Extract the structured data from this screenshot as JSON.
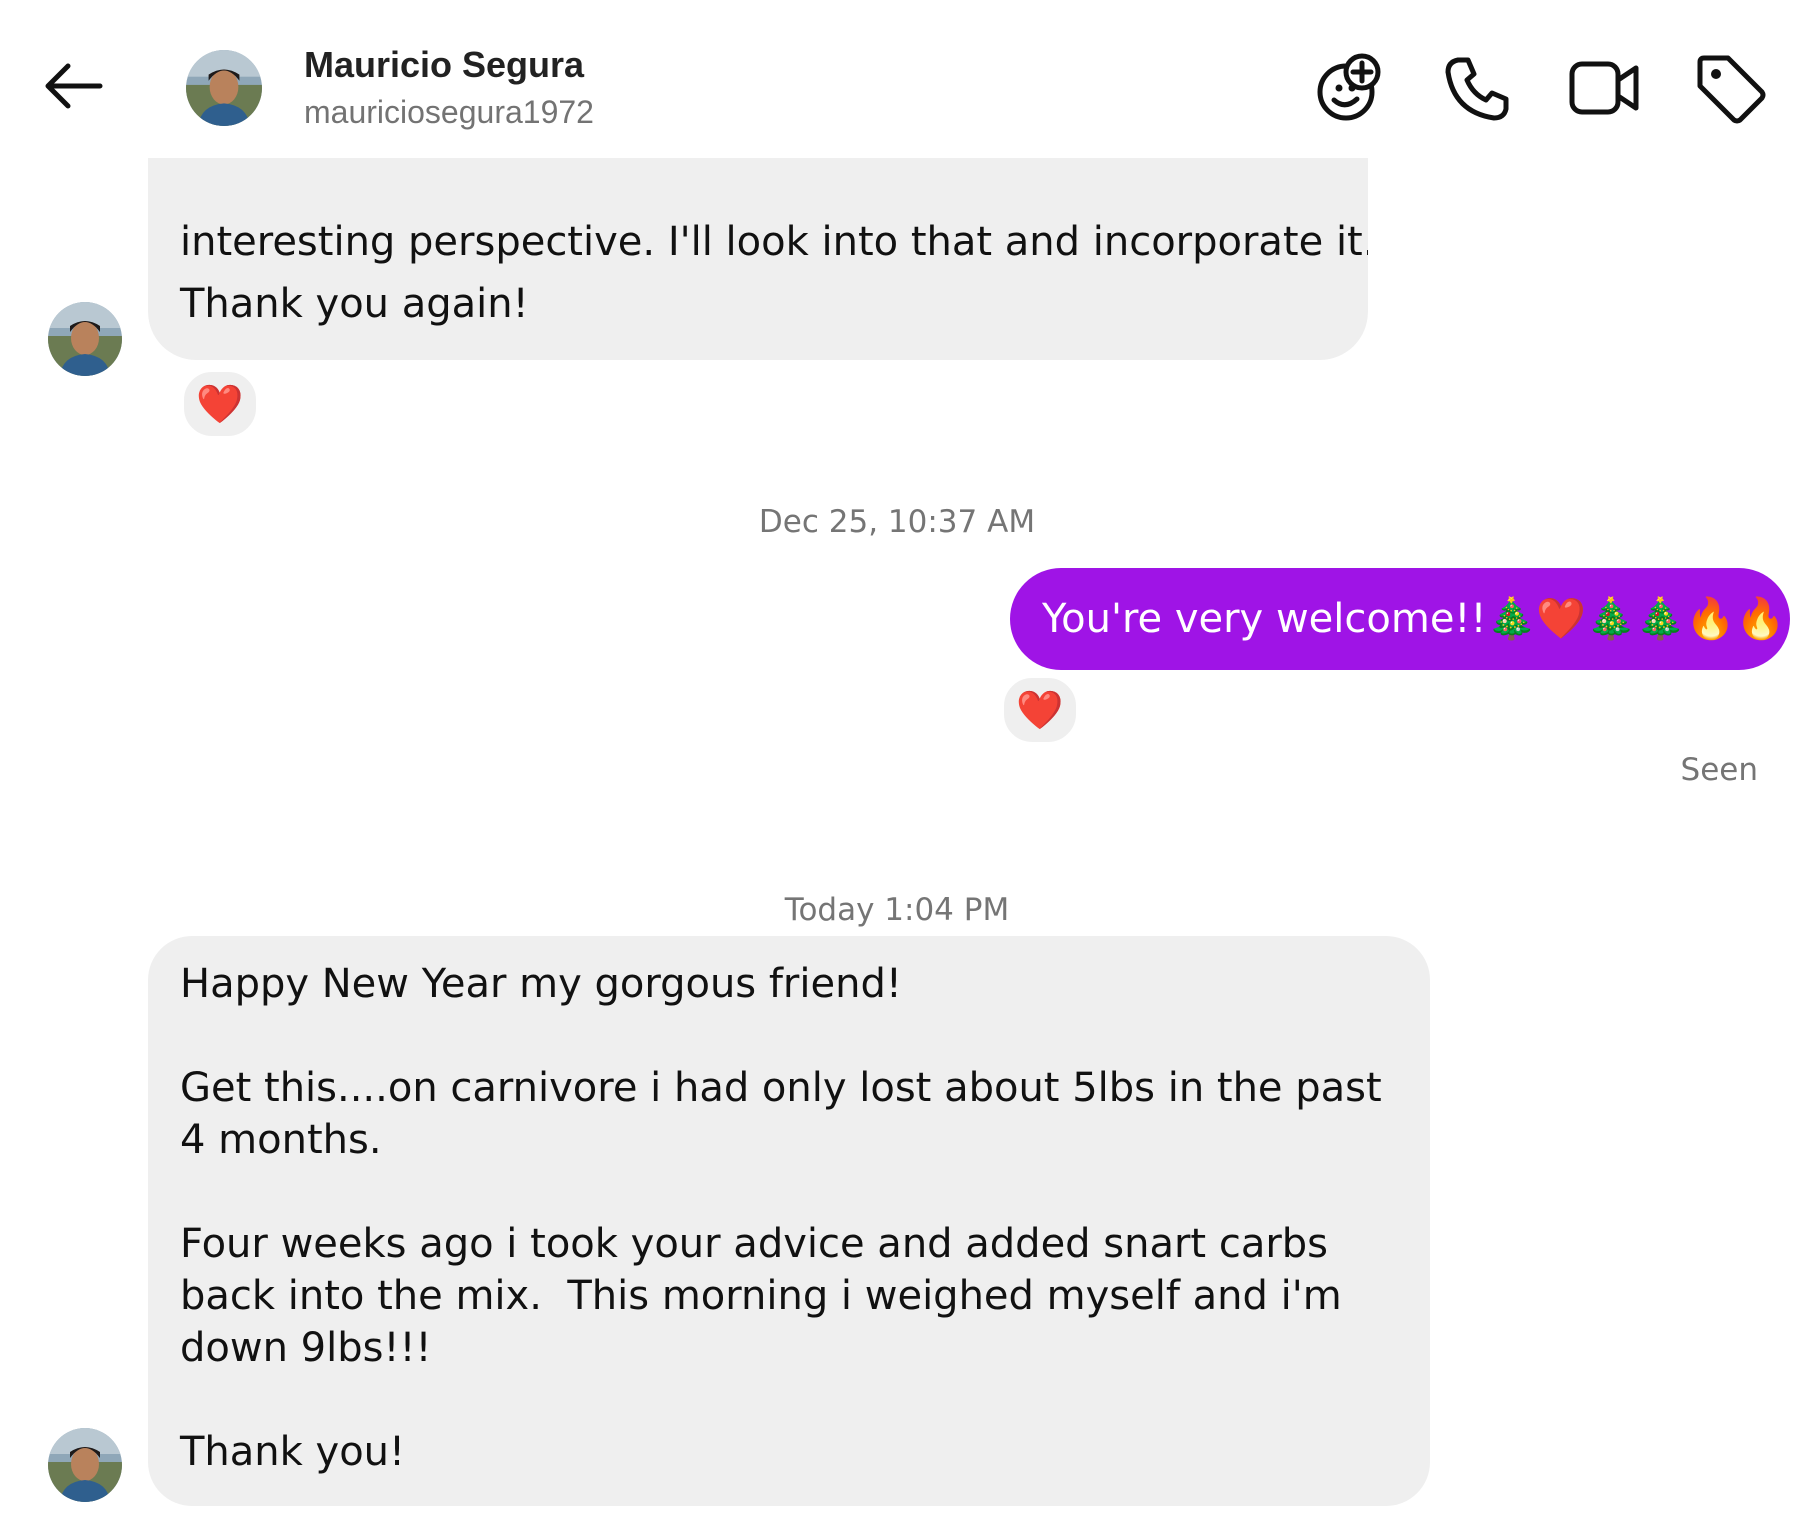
{
  "header": {
    "name": "Mauricio Segura",
    "username": "mauriciosegura1972",
    "icons": [
      "back-arrow-icon",
      "sticker-add-icon",
      "phone-icon",
      "video-icon",
      "tag-icon"
    ]
  },
  "messages": {
    "first": {
      "clipped_line": "interesting perspective. I'll look into that and incorporate it.",
      "line": "Thank you again!",
      "emojis": "🎄🎅❤️",
      "reaction": "❤️"
    },
    "timestamp1": "Dec 25, 10:37 AM",
    "outgoing": {
      "text": "You're very welcome!!🎄❤️🎄🎄🔥🔥",
      "reaction": "❤️",
      "status": "Seen"
    },
    "timestamp2": "Today 1:04 PM",
    "second": {
      "p1": "Happy New Year my gorgous friend!",
      "p2": "Get this....on carnivore i had only lost about 5lbs in the past 4 months.",
      "p3": "Four weeks ago i took your advice and added snart carbs back into the mix.  This morning i weighed myself and i'm down 9lbs!!!",
      "p4": "Thank you!"
    }
  },
  "colors": {
    "accent": "#9f14e6",
    "bubble_in": "#efefef",
    "muted_text": "#757575"
  }
}
